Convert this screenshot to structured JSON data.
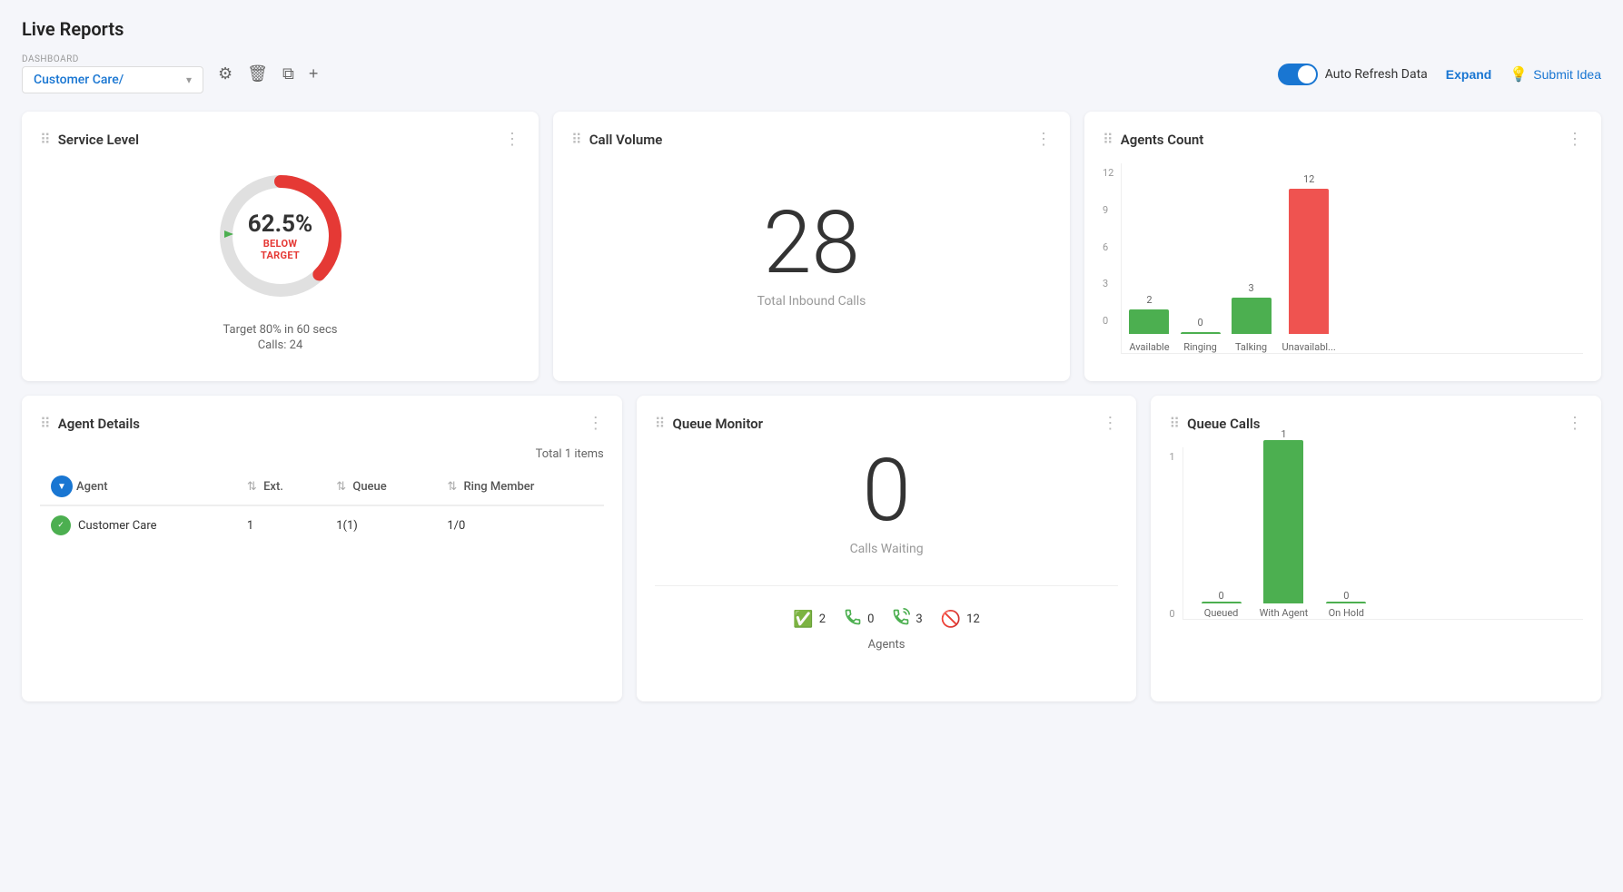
{
  "page": {
    "title": "Live Reports"
  },
  "toolbar": {
    "dashboard_label": "DASHBOARD",
    "dashboard_value": "Customer Care/",
    "auto_refresh_label": "Auto Refresh Data",
    "expand_label": "Expand",
    "submit_idea_label": "Submit Idea"
  },
  "service_level": {
    "title": "Service Level",
    "percent": "62.5%",
    "status": "BELOW TARGET",
    "target": "Target 80% in 60 secs",
    "calls": "Calls: 24"
  },
  "call_volume": {
    "title": "Call Volume",
    "number": "28",
    "label": "Total Inbound Calls"
  },
  "agents_count": {
    "title": "Agents Count",
    "bars": [
      {
        "label": "Available",
        "value": 2,
        "color": "green"
      },
      {
        "label": "Ringing",
        "value": 0,
        "color": "green"
      },
      {
        "label": "Talking",
        "value": 3,
        "color": "green"
      },
      {
        "label": "Unavailabl...",
        "value": 12,
        "color": "red"
      }
    ],
    "y_labels": [
      "12",
      "9",
      "6",
      "3",
      "0"
    ]
  },
  "agent_details": {
    "title": "Agent Details",
    "total": "Total 1 items",
    "columns": [
      "Agent",
      "Ext.",
      "Queue",
      "Ring Member"
    ],
    "rows": [
      {
        "agent": "Customer Care",
        "ext": "1",
        "queue": "1(1)",
        "ring_member": "1/0"
      }
    ]
  },
  "queue_monitor": {
    "title": "Queue Monitor",
    "number": "0",
    "label": "Calls Waiting",
    "stats": [
      {
        "icon": "✅",
        "value": "2"
      },
      {
        "icon": "📞",
        "value": "0"
      },
      {
        "icon": "📲",
        "value": "3"
      },
      {
        "icon": "🚫",
        "value": "12"
      }
    ],
    "agents_label": "Agents"
  },
  "queue_calls": {
    "title": "Queue Calls",
    "bars": [
      {
        "label": "Queued",
        "value": 0,
        "color": "green"
      },
      {
        "label": "With Agent",
        "value": 1,
        "color": "green"
      },
      {
        "label": "On Hold",
        "value": 0,
        "color": "green"
      }
    ],
    "y_labels": [
      "1",
      "0"
    ]
  }
}
